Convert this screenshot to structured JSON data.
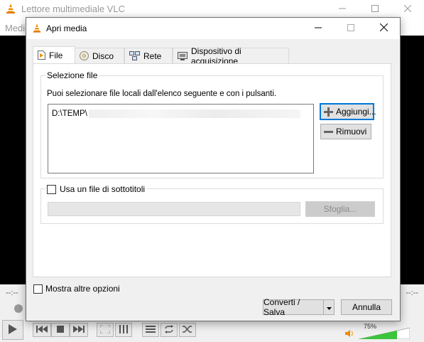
{
  "vlc": {
    "title": "Lettore multimediale VLC",
    "menu_partial": "Medi",
    "time_elapsed": "--:--",
    "time_total": "--:--",
    "volume_label": "75%",
    "volume_level": 0.75
  },
  "dialog": {
    "title": "Apri media",
    "tabs": [
      {
        "label": "File",
        "icon": "file-icon",
        "active": true
      },
      {
        "label": "Disco",
        "icon": "disc-icon",
        "active": false
      },
      {
        "label": "Rete",
        "icon": "network-icon",
        "active": false
      },
      {
        "label": "Dispositivo di acquisizione",
        "icon": "capture-device-icon",
        "active": false
      }
    ],
    "file_section": {
      "legend": "Selezione file",
      "hint": "Puoi selezionare file locali dall'elenco seguente e con i pulsanti.",
      "file_path": "D:\\TEMP\\",
      "add_label": "Aggiungi...",
      "remove_label": "Rimuovi"
    },
    "subtitle_section": {
      "checkbox_label": "Usa un file di sottotitoli",
      "checked": false,
      "input_value": "",
      "browse_label": "Sfoglia..."
    },
    "more_options_label": "Mostra altre opzioni",
    "more_options_checked": false,
    "convert_label": "Converti / Salva",
    "cancel_label": "Annulla"
  },
  "colors": {
    "accent": "#0078d7",
    "vlc_orange": "#f08c00",
    "volume_green": "#3cc43c"
  }
}
